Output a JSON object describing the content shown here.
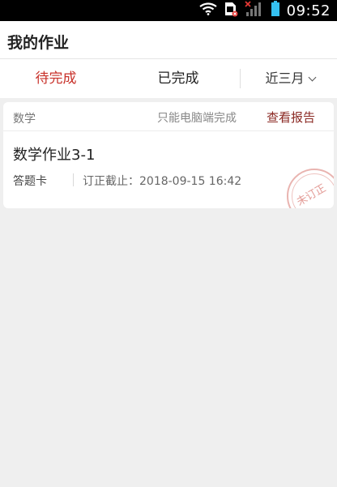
{
  "status_bar": {
    "time": "09:52",
    "icons": [
      "wifi-icon",
      "sim-card-icon",
      "signal-off-icon",
      "battery-icon"
    ],
    "colors": {
      "background": "#000000",
      "battery": "#35c1f1",
      "alert": "#e53935"
    }
  },
  "header": {
    "title": "我的作业"
  },
  "tabs": {
    "pending": "待完成",
    "done": "已完成",
    "range": "近三月",
    "active_color": "#c8312a"
  },
  "card": {
    "subject": "数学",
    "device_note": "只能电脑端完成",
    "view_report": "查看报告",
    "title": "数学作业3-1",
    "answer_card": "答题卡",
    "deadline": "订正截止：2018-09-15  16:42",
    "stamp_text": "未订正",
    "accent_color": "#8b2a24"
  }
}
